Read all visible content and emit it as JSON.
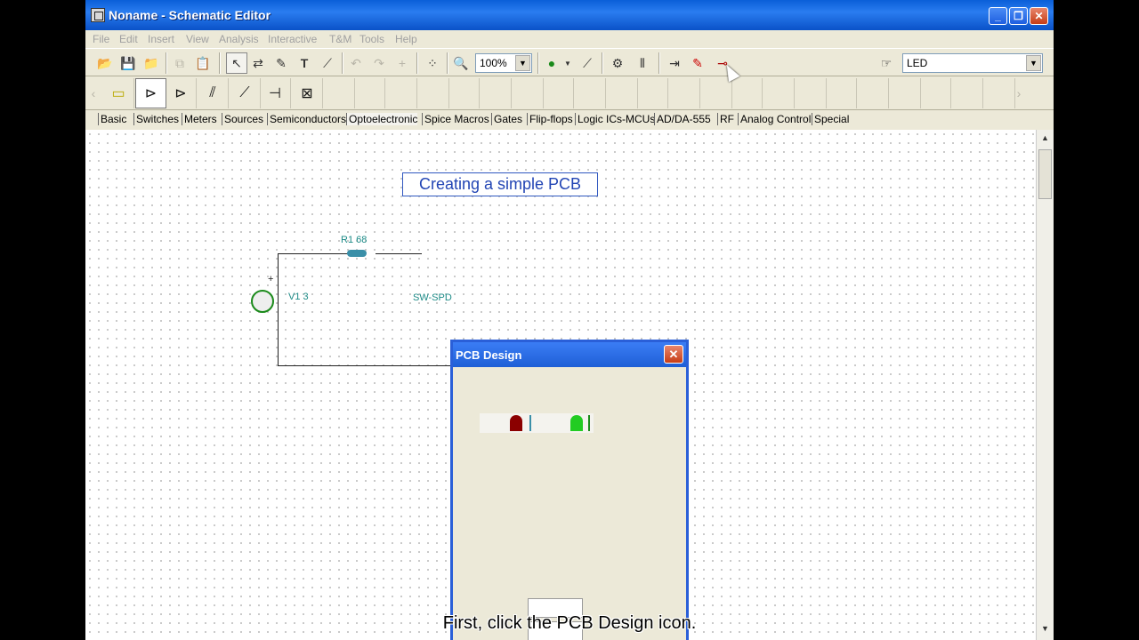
{
  "window": {
    "title": "Noname - Schematic Editor",
    "min": "_",
    "max": "❐",
    "close": "✕"
  },
  "menu": [
    "File",
    "Edit",
    "Insert",
    "View",
    "Analysis",
    "Interactive",
    "T&M",
    "Tools",
    "Help"
  ],
  "toolbar": {
    "zoom": "100%",
    "component_search": "LED"
  },
  "tabs": [
    "Basic",
    "Switches",
    "Meters",
    "Sources",
    "Semiconductors",
    "Optoelectronic",
    "Spice Macros",
    "Gates",
    "Flip-flops",
    "Logic ICs-MCUs",
    "AD/DA-555",
    "RF",
    "Analog Control",
    "Special"
  ],
  "active_tab": "Optoelectronic",
  "schematic": {
    "banner": "Creating a simple PCB",
    "r1_label": "R1 68",
    "v1_label": "V1 3",
    "switch_label": "SW-SPD",
    "plus": "+"
  },
  "dialog": {
    "title": "PCB Design",
    "close": "✕"
  },
  "caption": "First, click the PCB Design icon.",
  "colors": {
    "title_blue": "#0a5fd8",
    "led_red": "#8b0000",
    "led_green": "#22cc22",
    "wire_teal": "#1b8a86"
  }
}
